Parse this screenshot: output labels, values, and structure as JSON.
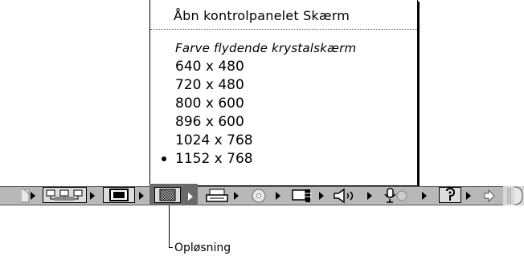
{
  "menu": {
    "header": "Åbn kontrolpanelet Skærm",
    "section_title": "Farve flydende krystalskærm",
    "resolutions": [
      "640 x 480",
      "720 x 480",
      "800 x 600",
      "896 x 600",
      "1024 x 768",
      "1152 x 768"
    ],
    "selected": "1152 x 768"
  },
  "control_strip": {
    "modules": [
      "file-sharing-icon",
      "appletalk-icon",
      "monitor-bit-depth-icon",
      "resolution-icon",
      "printer-icon",
      "cd-icon",
      "location-icon",
      "sound-volume-icon",
      "speech-icon",
      "keychain-icon",
      "scroll-right-icon"
    ]
  },
  "callout": {
    "label": "Opløsning"
  },
  "colors": {
    "strip_bg": "#b8b8b8",
    "active_module": "#6a6a6a",
    "menu_bg": "#ffffff"
  }
}
